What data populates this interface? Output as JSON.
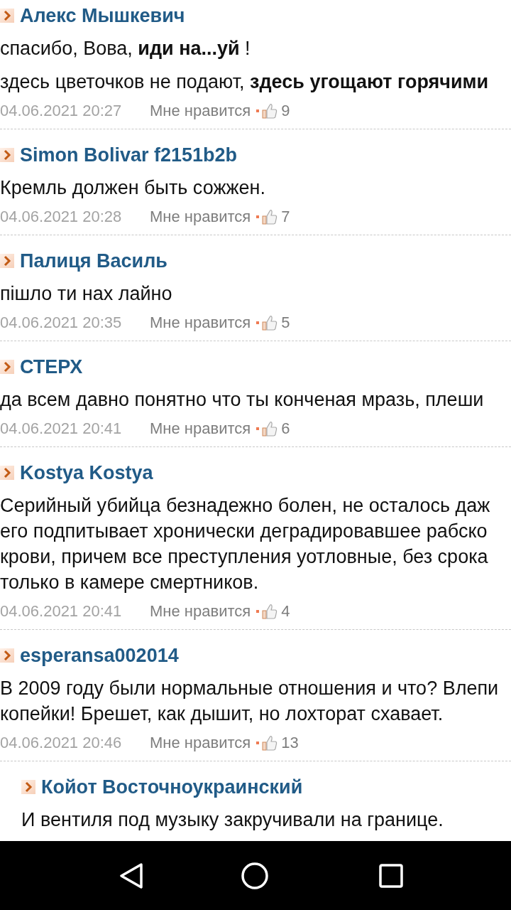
{
  "comments": [
    {
      "author": "Алекс Мышкевич",
      "paragraphs": [
        [
          "спасибо, Вова, **иди на...уй** !"
        ],
        [
          "здесь цветочков не подают, **здесь угощают горячими**"
        ]
      ],
      "date": "04.06.2021 20:27",
      "like_label": "Мне нравится",
      "likes": "9"
    },
    {
      "author": "Simon Bolivar f2151b2b",
      "paragraphs": [
        [
          "Кремль должен быть сожжен."
        ]
      ],
      "date": "04.06.2021 20:28",
      "like_label": "Мне нравится",
      "likes": "7"
    },
    {
      "author": "Палиця Василь",
      "paragraphs": [
        [
          "пішло ти нах лайно"
        ]
      ],
      "date": "04.06.2021 20:35",
      "like_label": "Мне нравится",
      "likes": "5"
    },
    {
      "author": "СТЕРХ",
      "paragraphs": [
        [
          "да всем давно понятно что ты конченая мразь, плеши"
        ]
      ],
      "date": "04.06.2021 20:41",
      "like_label": "Мне нравится",
      "likes": "6"
    },
    {
      "author": "Kostya Kostya",
      "paragraphs": [
        [
          "Серийный убийца безнадежно болен, не осталось даж",
          "его подпитывает хронически деградировавшее рабско",
          "крови, причем все преступления уотловные, без срока",
          "только в камере смертников."
        ]
      ],
      "date": "04.06.2021 20:41",
      "like_label": "Мне нравится",
      "likes": "4"
    },
    {
      "author": "esperansa002014",
      "paragraphs": [
        [
          "В 2009 году были нормальные отношения и что? Влепи",
          "копейки! Брешет, как дышит, но лохторат схавает."
        ]
      ],
      "date": "04.06.2021 20:46",
      "like_label": "Мне нравится",
      "likes": "13",
      "children": [
        {
          "author": "Койот Восточноукраинский",
          "paragraphs": [
            [
              "И вентиля под музыку закручивали на границе."
            ]
          ]
        }
      ]
    }
  ]
}
